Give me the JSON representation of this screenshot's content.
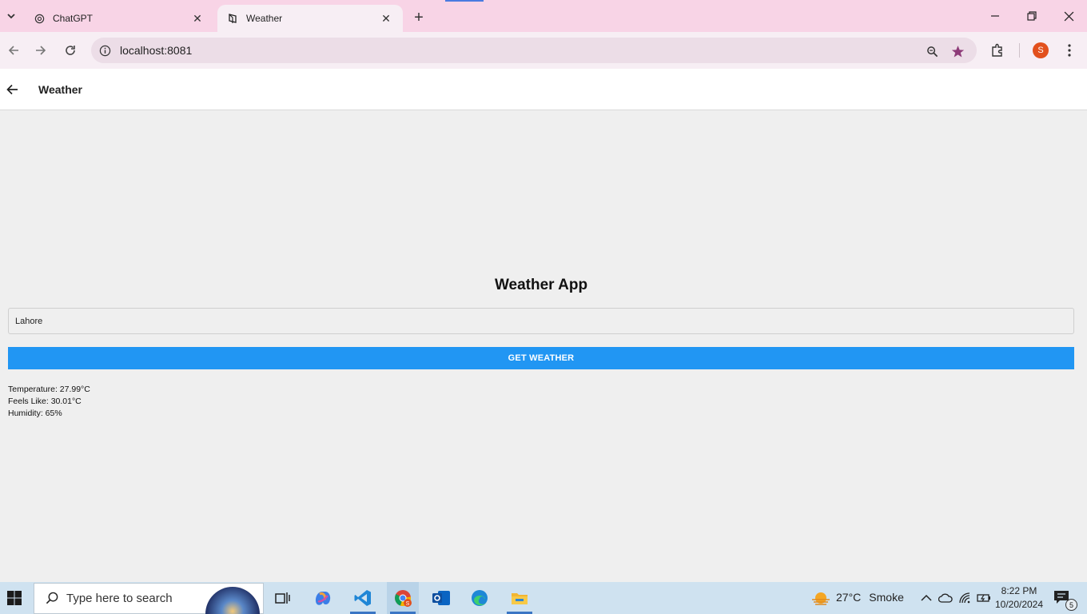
{
  "browser": {
    "tabs": [
      {
        "title": "ChatGPT"
      },
      {
        "title": "Weather"
      }
    ],
    "url": "localhost:8081",
    "profile_initial": "S"
  },
  "app": {
    "appbar_title": "Weather",
    "heading": "Weather App",
    "city_value": "Lahore",
    "button_label": "GET WEATHER",
    "results": {
      "temperature": "Temperature: 27.99°C",
      "feels_like": "Feels Like: 30.01°C",
      "humidity": "Humidity: 65%"
    },
    "accent_color": "#2196f3"
  },
  "taskbar": {
    "search_placeholder": "Type here to search",
    "weather_temp": "27°C",
    "weather_condition": "Smoke",
    "time": "8:22 PM",
    "date": "10/20/2024",
    "notification_count": "5"
  }
}
